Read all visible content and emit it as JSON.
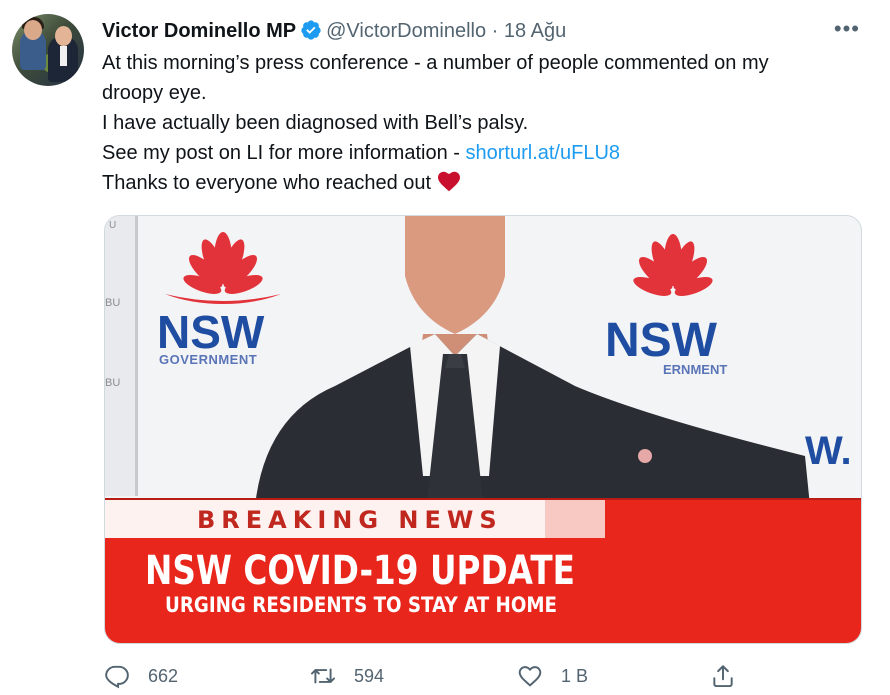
{
  "tweet": {
    "author_name": "Victor Dominello MP",
    "handle": "@VictorDominello",
    "separator": "·",
    "date": "18 Ağu",
    "more_label": "•••",
    "text_lines": [
      "At this morning’s press conference - a number of people commented on my",
      "droopy eye.",
      "I have actually been diagnosed with Bell’s palsy.",
      "See my post on LI for more information - ",
      "Thanks to everyone who reached out"
    ],
    "link": "shorturl.at/uFLU8"
  },
  "media": {
    "logo_text": "NSW",
    "logo_subtext": "GOVERNMENT",
    "logo_subtext_partial": "ERNMENT",
    "breaking_label": "BREAKING NEWS",
    "headline": "NSW COVID-19 UPDATE",
    "subheadline": "URGING RESIDENTS TO STAY AT HOME",
    "right_edge_text": "W.",
    "left_edge_fragments": [
      "BU",
      "BU",
      "U"
    ]
  },
  "actions": {
    "reply_count": "662",
    "retweet_count": "594",
    "like_count": "1 B"
  },
  "colors": {
    "accent": "#1d9bf0",
    "secondary_text": "#536471",
    "news_red": "#e8261c",
    "nsw_blue": "#1e4da1",
    "waratah_red": "#e3333a",
    "heart": "#c8102e"
  },
  "icons": [
    "verified-badge-icon",
    "more-icon",
    "heart-emoji-icon",
    "reply-icon",
    "retweet-icon",
    "like-icon",
    "share-icon"
  ]
}
